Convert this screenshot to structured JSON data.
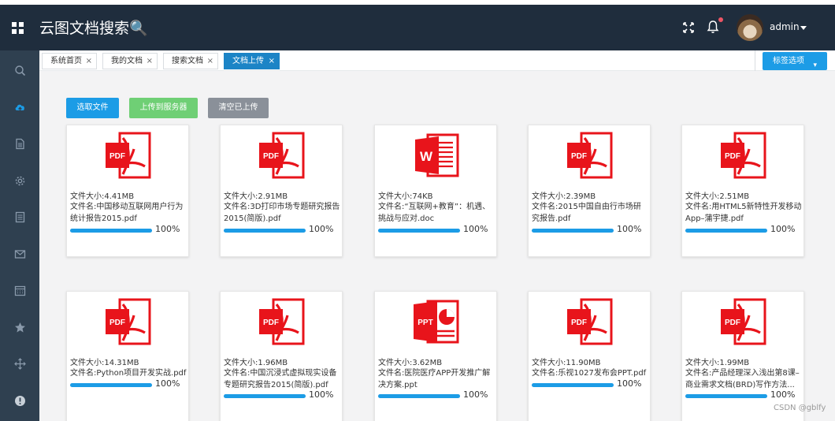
{
  "header": {
    "title": "云图文档搜索🔍",
    "user_name": "admin"
  },
  "sidebar": {
    "icons": [
      "search-icon",
      "cloud-upload-icon",
      "file-icon",
      "gear-icon",
      "list-icon",
      "mail-icon",
      "calendar-icon",
      "star-icon",
      "move-icon",
      "alert-icon"
    ],
    "active_index": 1
  },
  "tabs": {
    "items": [
      {
        "label": "系统首页",
        "close": "×"
      },
      {
        "label": "我的文档",
        "close": "×"
      },
      {
        "label": "搜索文档",
        "close": "×"
      },
      {
        "label": "文档上传",
        "close": "×"
      }
    ],
    "active_index": 3,
    "options_label": "标签选项",
    "options_caret": "▾"
  },
  "toolbar": {
    "select_label": "选取文件",
    "upload_label": "上传到服务器",
    "clear_label": "清空已上传"
  },
  "files": [
    {
      "type": "pdf",
      "size": "文件大小:4.41MB",
      "name": "文件名:中国移动互联网用户行为统计报告2015.pdf",
      "progress": 1.0,
      "progress_text": "100%"
    },
    {
      "type": "pdf",
      "size": "文件大小:2.91MB",
      "name": "文件名:3D打印市场专题研究报告2015(简版).pdf",
      "progress": 1.0,
      "progress_text": "100%"
    },
    {
      "type": "word",
      "size": "文件大小:74KB",
      "name": "文件名:“互联网+教育”：机遇、挑战与应对.doc",
      "progress": 1.0,
      "progress_text": "100%"
    },
    {
      "type": "pdf",
      "size": "文件大小:2.39MB",
      "name": "文件名:2015中国自由行市场研究报告.pdf",
      "progress": 1.0,
      "progress_text": "100%"
    },
    {
      "type": "pdf",
      "size": "文件大小:2.51MB",
      "name": "文件名:用HTML5新特性开发移动App–蒲宇捷.pdf",
      "progress": 1.0,
      "progress_text": "100%"
    },
    {
      "type": "pdf",
      "size": "文件大小:14.31MB",
      "name": "文件名:Python项目开发实战.pdf",
      "progress": 1.0,
      "progress_text": "100%"
    },
    {
      "type": "pdf",
      "size": "文件大小:1.96MB",
      "name": "文件名:中国沉浸式虚拟现实设备专题研究报告2015(简版).pdf",
      "progress": 1.0,
      "progress_text": "100%"
    },
    {
      "type": "ppt",
      "size": "文件大小:3.62MB",
      "name": "文件名:医院医疗APP开发推广解决方案.ppt",
      "progress": 1.0,
      "progress_text": "100%"
    },
    {
      "type": "pdf",
      "size": "文件大小:11.90MB",
      "name": "文件名:乐视1027发布会PPT.pdf",
      "progress": 1.0,
      "progress_text": "100%"
    },
    {
      "type": "pdf",
      "size": "文件大小:1.99MB",
      "name": "文件名:产品经理深入浅出第8课–商业需求文档(BRD)写作方法...",
      "progress": 1.0,
      "progress_text": "100%"
    }
  ],
  "icon_labels": {
    "pdf": "PDF",
    "word": "W",
    "ppt": "PPT"
  },
  "colors": {
    "header_bg": "#1f2d3d",
    "sidebar_bg": "#2f4050",
    "accent": "#1c9ce6",
    "upload_green": "#6fcf75",
    "clear_gray": "#8a9099",
    "file_red": "#e8141b"
  },
  "watermark": "CSDN @gblfy"
}
